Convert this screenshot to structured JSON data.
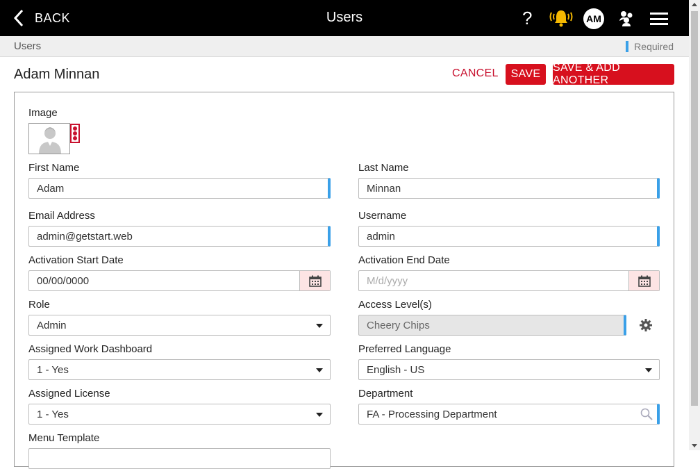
{
  "header": {
    "back_label": "BACK",
    "title": "Users",
    "help_label": "?",
    "user_initials": "AM",
    "icons": [
      "chevron-left-icon",
      "bell-icon",
      "people-icon",
      "hamburger-menu-icon"
    ]
  },
  "breadcrumb": {
    "label": "Users",
    "required_label": "Required"
  },
  "page": {
    "title": "Adam Minnan"
  },
  "actions": {
    "cancel": "CANCEL",
    "save": "SAVE",
    "save_add": "SAVE & ADD ANOTHER"
  },
  "form": {
    "image_label": "Image",
    "first_name": {
      "label": "First Name",
      "value": "Adam"
    },
    "last_name": {
      "label": "Last Name",
      "value": "Minnan"
    },
    "email": {
      "label": "Email Address",
      "value": "admin@getstart.web"
    },
    "username": {
      "label": "Username",
      "value": "admin"
    },
    "activation_start": {
      "label": "Activation Start Date",
      "value": "00/00/0000"
    },
    "activation_end": {
      "label": "Activation End Date",
      "placeholder": "M/d/yyyy"
    },
    "role": {
      "label": "Role",
      "value": "Admin"
    },
    "access_levels": {
      "label": "Access Level(s)",
      "value": "Cheery Chips"
    },
    "assigned_dashboard": {
      "label": "Assigned Work Dashboard",
      "value": "1 - Yes"
    },
    "preferred_language": {
      "label": "Preferred Language",
      "value": "English - US"
    },
    "assigned_license": {
      "label": "Assigned License",
      "value": "1 - Yes"
    },
    "department": {
      "label": "Department",
      "value": "FA - Processing Department"
    },
    "menu_template": {
      "label": "Menu Template"
    }
  },
  "colors": {
    "accent_red": "#d7101e",
    "required_blue": "#3aa0e8",
    "bell_yellow": "#f5b800"
  }
}
